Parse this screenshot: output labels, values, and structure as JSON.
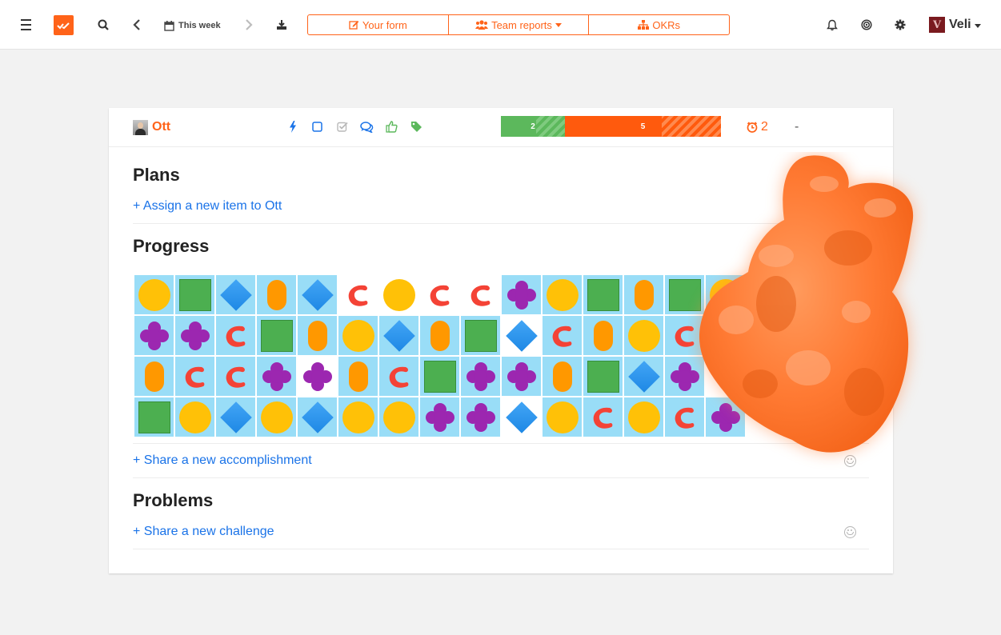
{
  "topbar": {
    "week_label": "This week",
    "nav": [
      {
        "label": "Your form"
      },
      {
        "label": "Team reports"
      },
      {
        "label": "OKRs"
      }
    ],
    "user_initial": "V",
    "user_name": "Veli"
  },
  "card": {
    "person_name": "Ott",
    "progress_done": "2",
    "progress_remaining": "5",
    "timer_count": "2",
    "dash": "-",
    "plans_title": "Plans",
    "plans_link": "+ Assign a new item to Ott",
    "progress_title": "Progress",
    "progress_link": "+ Share a new accomplishment",
    "problems_title": "Problems",
    "problems_link": "+ Share a new challenge"
  },
  "game_grid": [
    [
      "circle",
      "square",
      "diamond",
      "pill",
      "diamond",
      "c",
      "circle",
      "c",
      "c",
      "flower",
      "circle",
      "square",
      "pill",
      "square",
      "circle"
    ],
    [
      "flower",
      "flower",
      "c",
      "square",
      "pill",
      "circle",
      "diamond",
      "pill",
      "square",
      "diamond",
      "c",
      "pill",
      "circle",
      "c",
      "none"
    ],
    [
      "pill",
      "c",
      "c",
      "flower",
      "flower",
      "pill",
      "c",
      "square",
      "flower",
      "flower",
      "pill",
      "square",
      "diamond",
      "flower",
      "none"
    ],
    [
      "square",
      "circle",
      "diamond",
      "circle",
      "diamond",
      "circle",
      "circle",
      "flower",
      "flower",
      "diamond",
      "circle",
      "c",
      "circle",
      "c",
      "flower"
    ]
  ],
  "game_grid_no_bg": [
    [
      0,
      5
    ],
    [
      0,
      6
    ],
    [
      0,
      7
    ],
    [
      0,
      8
    ],
    [
      1,
      9
    ],
    [
      2,
      4
    ],
    [
      3,
      9
    ]
  ],
  "colors": {
    "accent": "#ff6319",
    "link": "#1a73e8",
    "progress_done": "#5cb85c",
    "progress_remaining": "#ff5a0d",
    "cell_bg": "#99ddf7"
  },
  "icons": [
    "menu-icon",
    "search-icon",
    "chevron-left-icon",
    "calendar-icon",
    "chevron-right-icon",
    "download-icon",
    "edit-icon",
    "users-icon",
    "sitemap-icon",
    "bell-icon",
    "target-icon",
    "gear-icon",
    "bolt-icon",
    "square-icon",
    "check-square-icon",
    "comments-icon",
    "thumbs-up-icon",
    "tag-icon",
    "clock-icon",
    "smiley-icon"
  ]
}
